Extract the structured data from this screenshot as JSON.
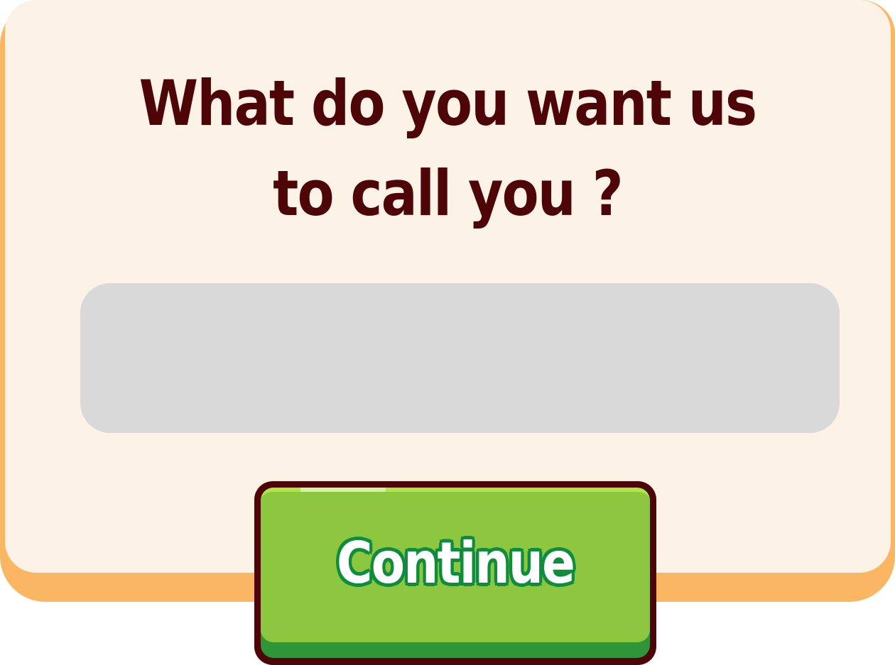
{
  "dialog": {
    "title_line1": "What do you want us",
    "title_line2": "to call you ?"
  },
  "name_input": {
    "value": "",
    "placeholder": ""
  },
  "continue_button": {
    "label": "Continue"
  },
  "colors": {
    "card_background": "#fdf2e6",
    "card_shadow": "#fbb664",
    "title_text": "#4e0508",
    "input_background": "#d9d9d9",
    "button_face": "#8dc63f",
    "button_base": "#2e9636",
    "button_outline": "#4e0508",
    "button_label_outline": "#0f8c3d"
  }
}
